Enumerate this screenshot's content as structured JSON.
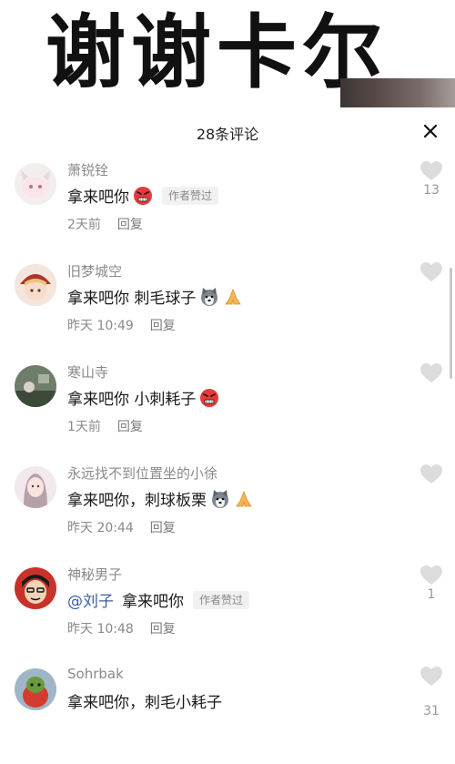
{
  "banner": {
    "title": "谢谢卡尔"
  },
  "header": {
    "title": "28条评论"
  },
  "comments": [
    {
      "username": "萧锐铨",
      "text": "拿来吧你",
      "mention": "",
      "emojis": [
        "angry-face"
      ],
      "author_badge": "作者赞过",
      "time": "2天前",
      "reply": "回复",
      "likes": "13"
    },
    {
      "username": "旧梦城空",
      "text": "拿来吧你 刺毛球子",
      "mention": "",
      "emojis": [
        "husky-face",
        "praying-hands"
      ],
      "author_badge": "",
      "time": "昨天 10:49",
      "reply": "回复",
      "likes": ""
    },
    {
      "username": "寒山寺",
      "text": "拿来吧你 小刺耗子",
      "mention": "",
      "emojis": [
        "angry-face"
      ],
      "author_badge": "",
      "time": "1天前",
      "reply": "回复",
      "likes": ""
    },
    {
      "username": "永远找不到位置坐的小徐",
      "text": "拿来吧你，刺球板栗",
      "mention": "",
      "emojis": [
        "husky-face",
        "praying-hands"
      ],
      "author_badge": "",
      "time": "昨天 20:44",
      "reply": "回复",
      "likes": ""
    },
    {
      "username": "神秘男子",
      "text": "拿来吧你",
      "mention": "@刘子",
      "emojis": [],
      "author_badge": "作者赞过",
      "time": "昨天 10:48",
      "reply": "回复",
      "likes": "1"
    },
    {
      "username": "Sohrbak",
      "text": "拿来吧你，刺毛小耗子",
      "mention": "",
      "emojis": [],
      "author_badge": "",
      "time": "",
      "reply": "",
      "likes": "31"
    }
  ],
  "colors": {
    "like_icon": "#dcdcdc",
    "mention": "#3a5fa0",
    "angry_face": "#e23b3b"
  },
  "icons": {
    "close": "close-icon",
    "like": "heart-icon"
  }
}
